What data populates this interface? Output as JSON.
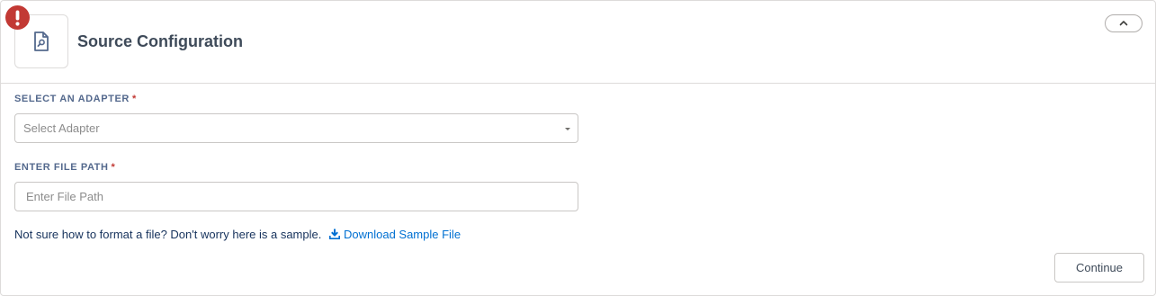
{
  "header": {
    "title": "Source Configuration",
    "icon": "file-search-icon",
    "status_icon": "error-icon",
    "collapse_icon": "chevron-up-icon"
  },
  "adapter": {
    "label": "SELECT AN ADAPTER",
    "required_marker": "*",
    "placeholder": "Select Adapter",
    "value": ""
  },
  "file_path": {
    "label": "ENTER FILE PATH",
    "required_marker": "*",
    "placeholder": "Enter File Path",
    "value": ""
  },
  "help": {
    "text": "Not sure how to format a file? Don't worry here is a sample.",
    "link_label": "Download Sample File",
    "link_icon": "download-icon"
  },
  "actions": {
    "continue_label": "Continue"
  },
  "colors": {
    "error": "#c23934",
    "link": "#0070d2",
    "title": "#3e4a59"
  }
}
